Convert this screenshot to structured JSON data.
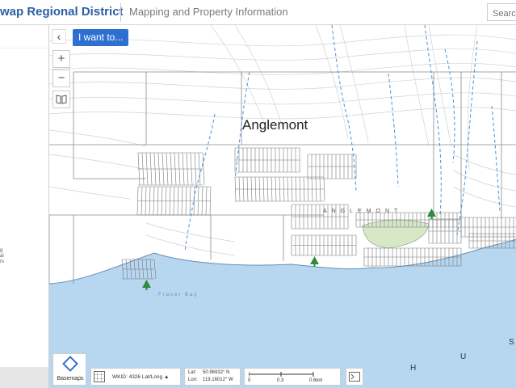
{
  "header": {
    "brand": "wap Regional District",
    "subtitle": "Mapping and Property Information",
    "search_placeholder": "Searc"
  },
  "map": {
    "place_label": "Anglemont",
    "street_label": "ANGLEMONT",
    "bay_label": "Fraser Bay",
    "map_letters": [
      "H",
      "U",
      "S"
    ],
    "colors": {
      "water": "#b7d6f0",
      "land": "#ffffff",
      "parcel_line": "#7a7a7a",
      "stream": "#4a90d9",
      "contour": "#cfcfcf",
      "park": "#d7e8c7",
      "tree": "#2e8b3d"
    }
  },
  "controls": {
    "collapse_glyph": "‹",
    "i_want_to": "I want to...",
    "zoom_in": "+",
    "zoom_out": "−",
    "bookmark_icon": "book-icon"
  },
  "footer": {
    "basemaps": "Basemaps",
    "projection": "WKID: 4326 Lat/Long ▲",
    "lat_label": "Lat:",
    "lat_value": "50.96932° N",
    "lon_label": "Lon:",
    "lon_value": "119.16012° W",
    "scale_0": "0",
    "scale_1": "0.3",
    "scale_2": "0.6km"
  },
  "sidebar_fragments": [
    "g",
    "al",
    "rs"
  ]
}
